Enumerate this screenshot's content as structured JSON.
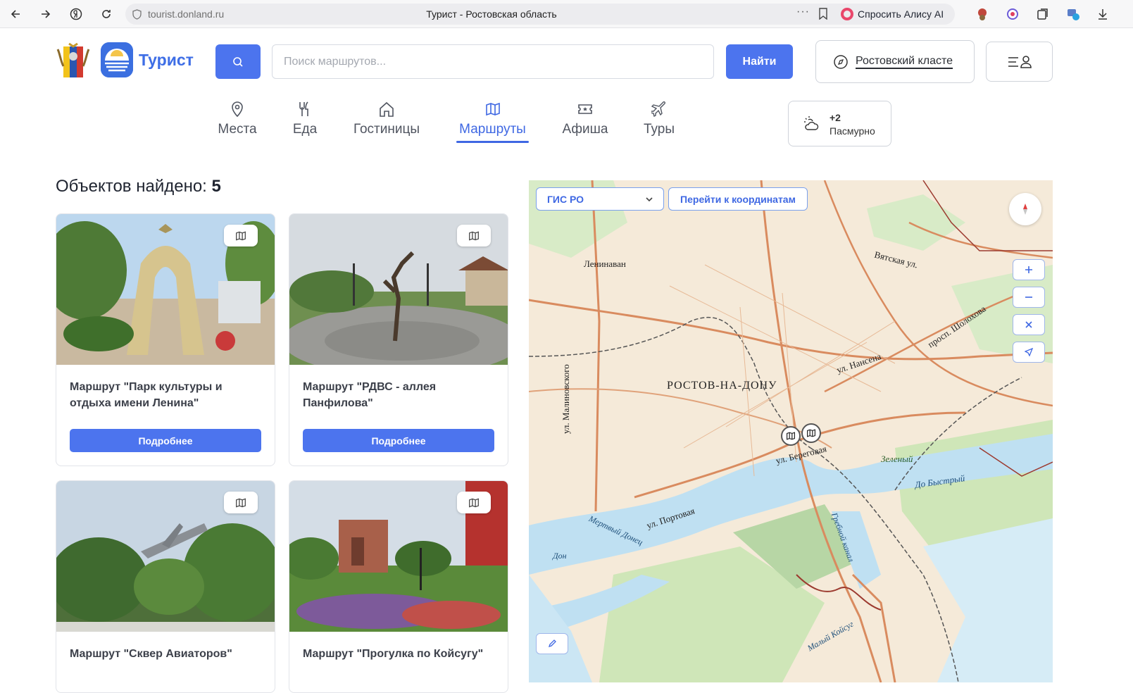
{
  "browser": {
    "url": "tourist.donland.ru",
    "tab_title": "Турист - Ростовская область",
    "alice_label": "Спросить Алису AI",
    "more_dots": "···"
  },
  "header": {
    "logo_text": "Турист",
    "search_placeholder": "Поиск маршрутов...",
    "find_label": "Найти",
    "cluster_label": "Ростовский класте"
  },
  "categories": [
    {
      "label": "Места",
      "icon": "map-pin-icon"
    },
    {
      "label": "Еда",
      "icon": "fork-knife-icon"
    },
    {
      "label": "Гостиницы",
      "icon": "house-icon"
    },
    {
      "label": "Маршруты",
      "icon": "map-icon",
      "active": true
    },
    {
      "label": "Афиша",
      "icon": "ticket-icon"
    },
    {
      "label": "Туры",
      "icon": "plane-icon"
    }
  ],
  "weather": {
    "temp": "+2",
    "desc": "Пасмурно",
    "icon": "cloud-sun-icon"
  },
  "results": {
    "label": "Объектов найдено:",
    "count": "5"
  },
  "cards": [
    {
      "title": "Маршрут \"Парк культуры и отдыха имени Ленина\"",
      "button": "Подробнее"
    },
    {
      "title": "Маршрут \"РДВС - аллея Панфилова\"",
      "button": "Подробнее"
    },
    {
      "title": "Маршрут \"Сквер Авиаторов\""
    },
    {
      "title": "Маршрут \"Прогулка по Койсугу\""
    }
  ],
  "map": {
    "layer_select": "ГИС РО",
    "coords_button": "Перейти к координатам",
    "labels": {
      "city": "РОСТОВ-НА-ДОНУ",
      "leninavan": "Ленинаван",
      "vyatskaya": "Вятская ул.",
      "sholokhova": "просп. Шолохова",
      "nansena": "ул. Нансена",
      "malinovskogo": "ул. Малиновского",
      "beregovaya": "ул. Береговая",
      "portovaya": "ул. Портовая",
      "zeleny": "Зеленый",
      "do_bystry": "До Быстрый",
      "grebnoy": "Гребной канал",
      "mertvy": "Мертвый Донец",
      "don": "Дон",
      "maly": "Малый Койсуг"
    },
    "colors": {
      "land": "#f5ead9",
      "water": "#bfe0f2",
      "green": "#cfe6b8",
      "road": "#d98b5f",
      "border": "#9c3a2f"
    }
  },
  "colors": {
    "accent": "#4c74ee",
    "accent_text": "#3f68e3"
  }
}
